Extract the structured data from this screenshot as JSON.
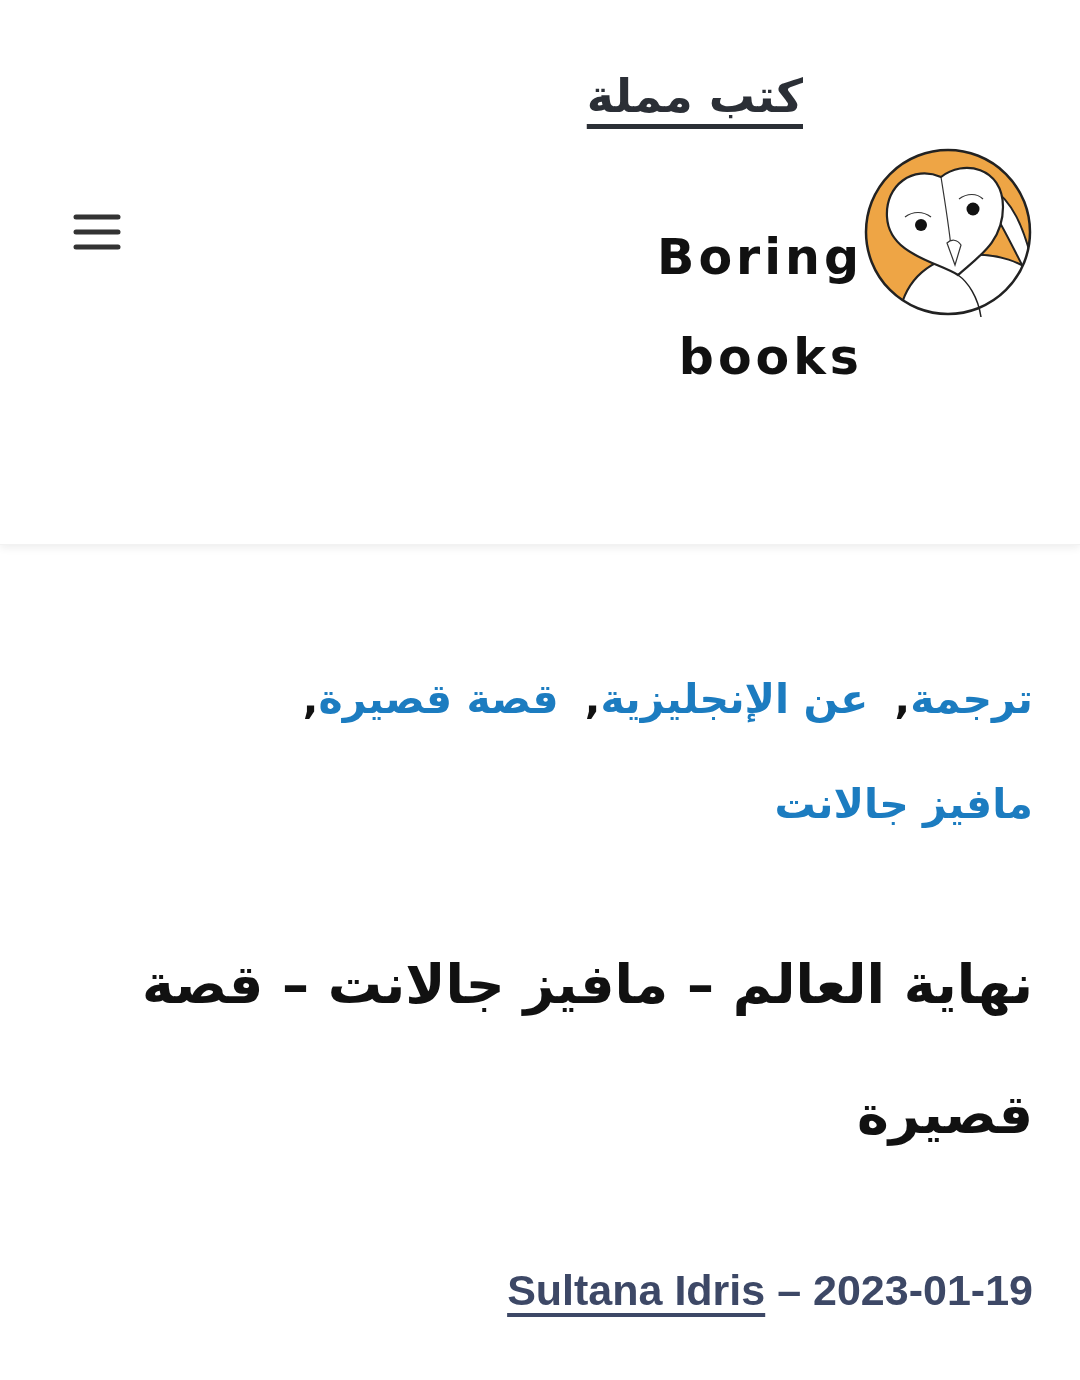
{
  "header": {
    "site_title": "كتب مملة",
    "site_description": "Boring books"
  },
  "post": {
    "categories": [
      {
        "label": "ترجمة",
        "separator": ","
      },
      {
        "label": "عن الإنجليزية",
        "separator": ","
      },
      {
        "label": "قصة قصيرة",
        "separator": ","
      },
      {
        "label": "مافيز جالانت"
      }
    ],
    "title": "نهاية العالم – مافيز جالانت – قصة قصيرة",
    "meta": {
      "author": "Sultana Idris",
      "separator": "–",
      "date": "2023-01-19"
    }
  }
}
